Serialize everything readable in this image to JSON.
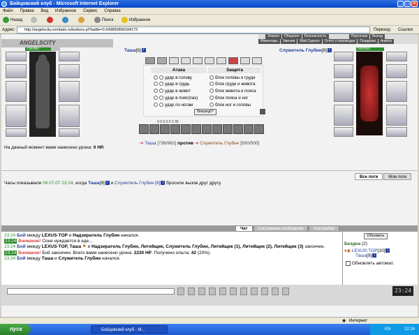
{
  "window": {
    "title": "Бойцовский клуб - Microsoft Internet Explorer"
  },
  "menu": [
    "Файл",
    "Правка",
    "Вид",
    "Избранное",
    "Сервис",
    "Справка"
  ],
  "toolbar": {
    "back": "Назад",
    "search": "Поиск",
    "favorites": "Избранное"
  },
  "address": {
    "label": "Адрес:",
    "url": "http://angelscity.combats.ru/buttons.pl?battle=0.643850899184173",
    "go": "Переход",
    "links": "Ссылки"
  },
  "topnav": {
    "row1": [
      "Знания",
      "Общение",
      "Безопасность",
      "Персонаж",
      "Выход"
    ],
    "row2": [
      "Инвентарь",
      "Умения",
      "Мой Скролл",
      "Отчет о переводах",
      "Поединки",
      "Анкета"
    ]
  },
  "logo": "ANGELSCITY",
  "player": {
    "name": "Таша",
    "level": "[9]",
    "hp_bar": "736/982",
    "hp": "[736/982]",
    "hp_fraction": 0.7495
  },
  "enemy": {
    "name": "Служитель Глубин",
    "level": "[8]",
    "hp_bar": "500/500",
    "hp": "[500/500]",
    "hp_fraction": 1.0
  },
  "attack": {
    "title": "Атака",
    "items": [
      "удар в голову",
      "удар в грудь",
      "удар в живот",
      "удар в пояс(пах)",
      "удар по ногам"
    ]
  },
  "defense": {
    "title": "Защита",
    "items": [
      "блок головы и груди",
      "блок груди и живота",
      "блок живота и пояса",
      "блок пояса и ног",
      "блок ног и головы"
    ]
  },
  "fwd_button": "Вперед!!!",
  "stats_line": "0   0   0   0   0   0   30",
  "versus": "против",
  "damage_line": {
    "text": "На данный момент вами нанесено урона:",
    "value": "0 HP."
  },
  "log_tabs": [
    "Все логи",
    "Мои логи"
  ],
  "clock_line": {
    "a": "Часы показывали",
    "time": "06.07.07 23:24",
    "b": ", когда",
    "c": "и",
    "d": "бросили вызов друг другу.",
    "enemy": "Служитель Глубин [8]"
  },
  "chat_tabs": [
    "Чат",
    "Системные сообщения",
    "Настройки"
  ],
  "chat": {
    "l1": {
      "time": "23:24",
      "word": "Бой",
      "rest": "между",
      "a": "LEXUS-TOP",
      "and": "и",
      "b": "Надзиратель Глубин",
      "end": "начался."
    },
    "l2": {
      "time": "23:24",
      "warn": "Внимание!",
      "rest": "Соня нуждается в еде..."
    },
    "l3": {
      "time": "23:24",
      "word": "Бой",
      "rest": "между",
      "a": "LEXUS-TOP, Таша",
      "and": "и",
      "b": "Надзиратель Глубин, Литейщик, Служитель Глубин, Литейщик (1), Литейщик (2), Литейщик (3)",
      "end": "закончен."
    },
    "l4": {
      "time": "23:24",
      "warn": "Внимание!",
      "rest": "Бой закончен. Всего вами нанесено урона:",
      "dmg": "2230 HP",
      "exp": ". Получено опыта:",
      "expv": "42",
      "pct": "(20%)."
    },
    "l5": {
      "time": "23:24",
      "word": "Бой",
      "rest": "между",
      "a": "Таша",
      "and": "и",
      "b": "Служитель Глубин",
      "end": "начался."
    }
  },
  "who": {
    "refresh": "Обновить",
    "room": "Бездна",
    "count": "(2)",
    "u1": "LEXUS-TOP",
    "u1l": "[10]",
    "u2": "Таша",
    "u2l": "[9]",
    "auto": "Обновлять автомат."
  },
  "game_clock": "23:24",
  "statusbar": {
    "internet": "Интернет"
  },
  "taskbar": {
    "start": "пуск",
    "task": "Бойцовский клуб - M...",
    "lang": "EN",
    "clock": "22:24"
  }
}
